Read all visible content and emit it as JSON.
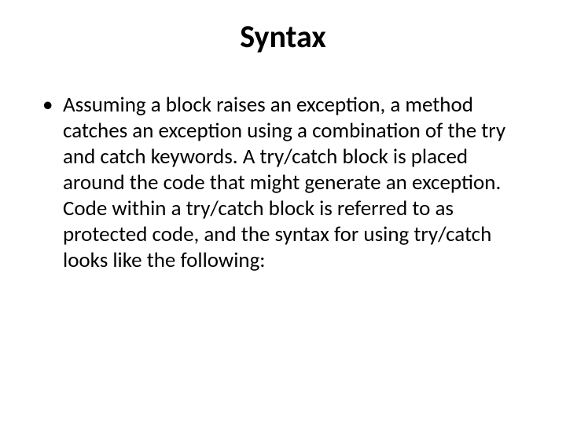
{
  "slide": {
    "title": "Syntax",
    "bullets": [
      "Assuming a block raises an exception, a method catches an exception using a combination of the try and catch keywords. A try/catch block is placed around the code that might generate an exception. Code within a try/catch block is referred to as protected code, and the syntax for using try/catch looks like the following:"
    ]
  }
}
